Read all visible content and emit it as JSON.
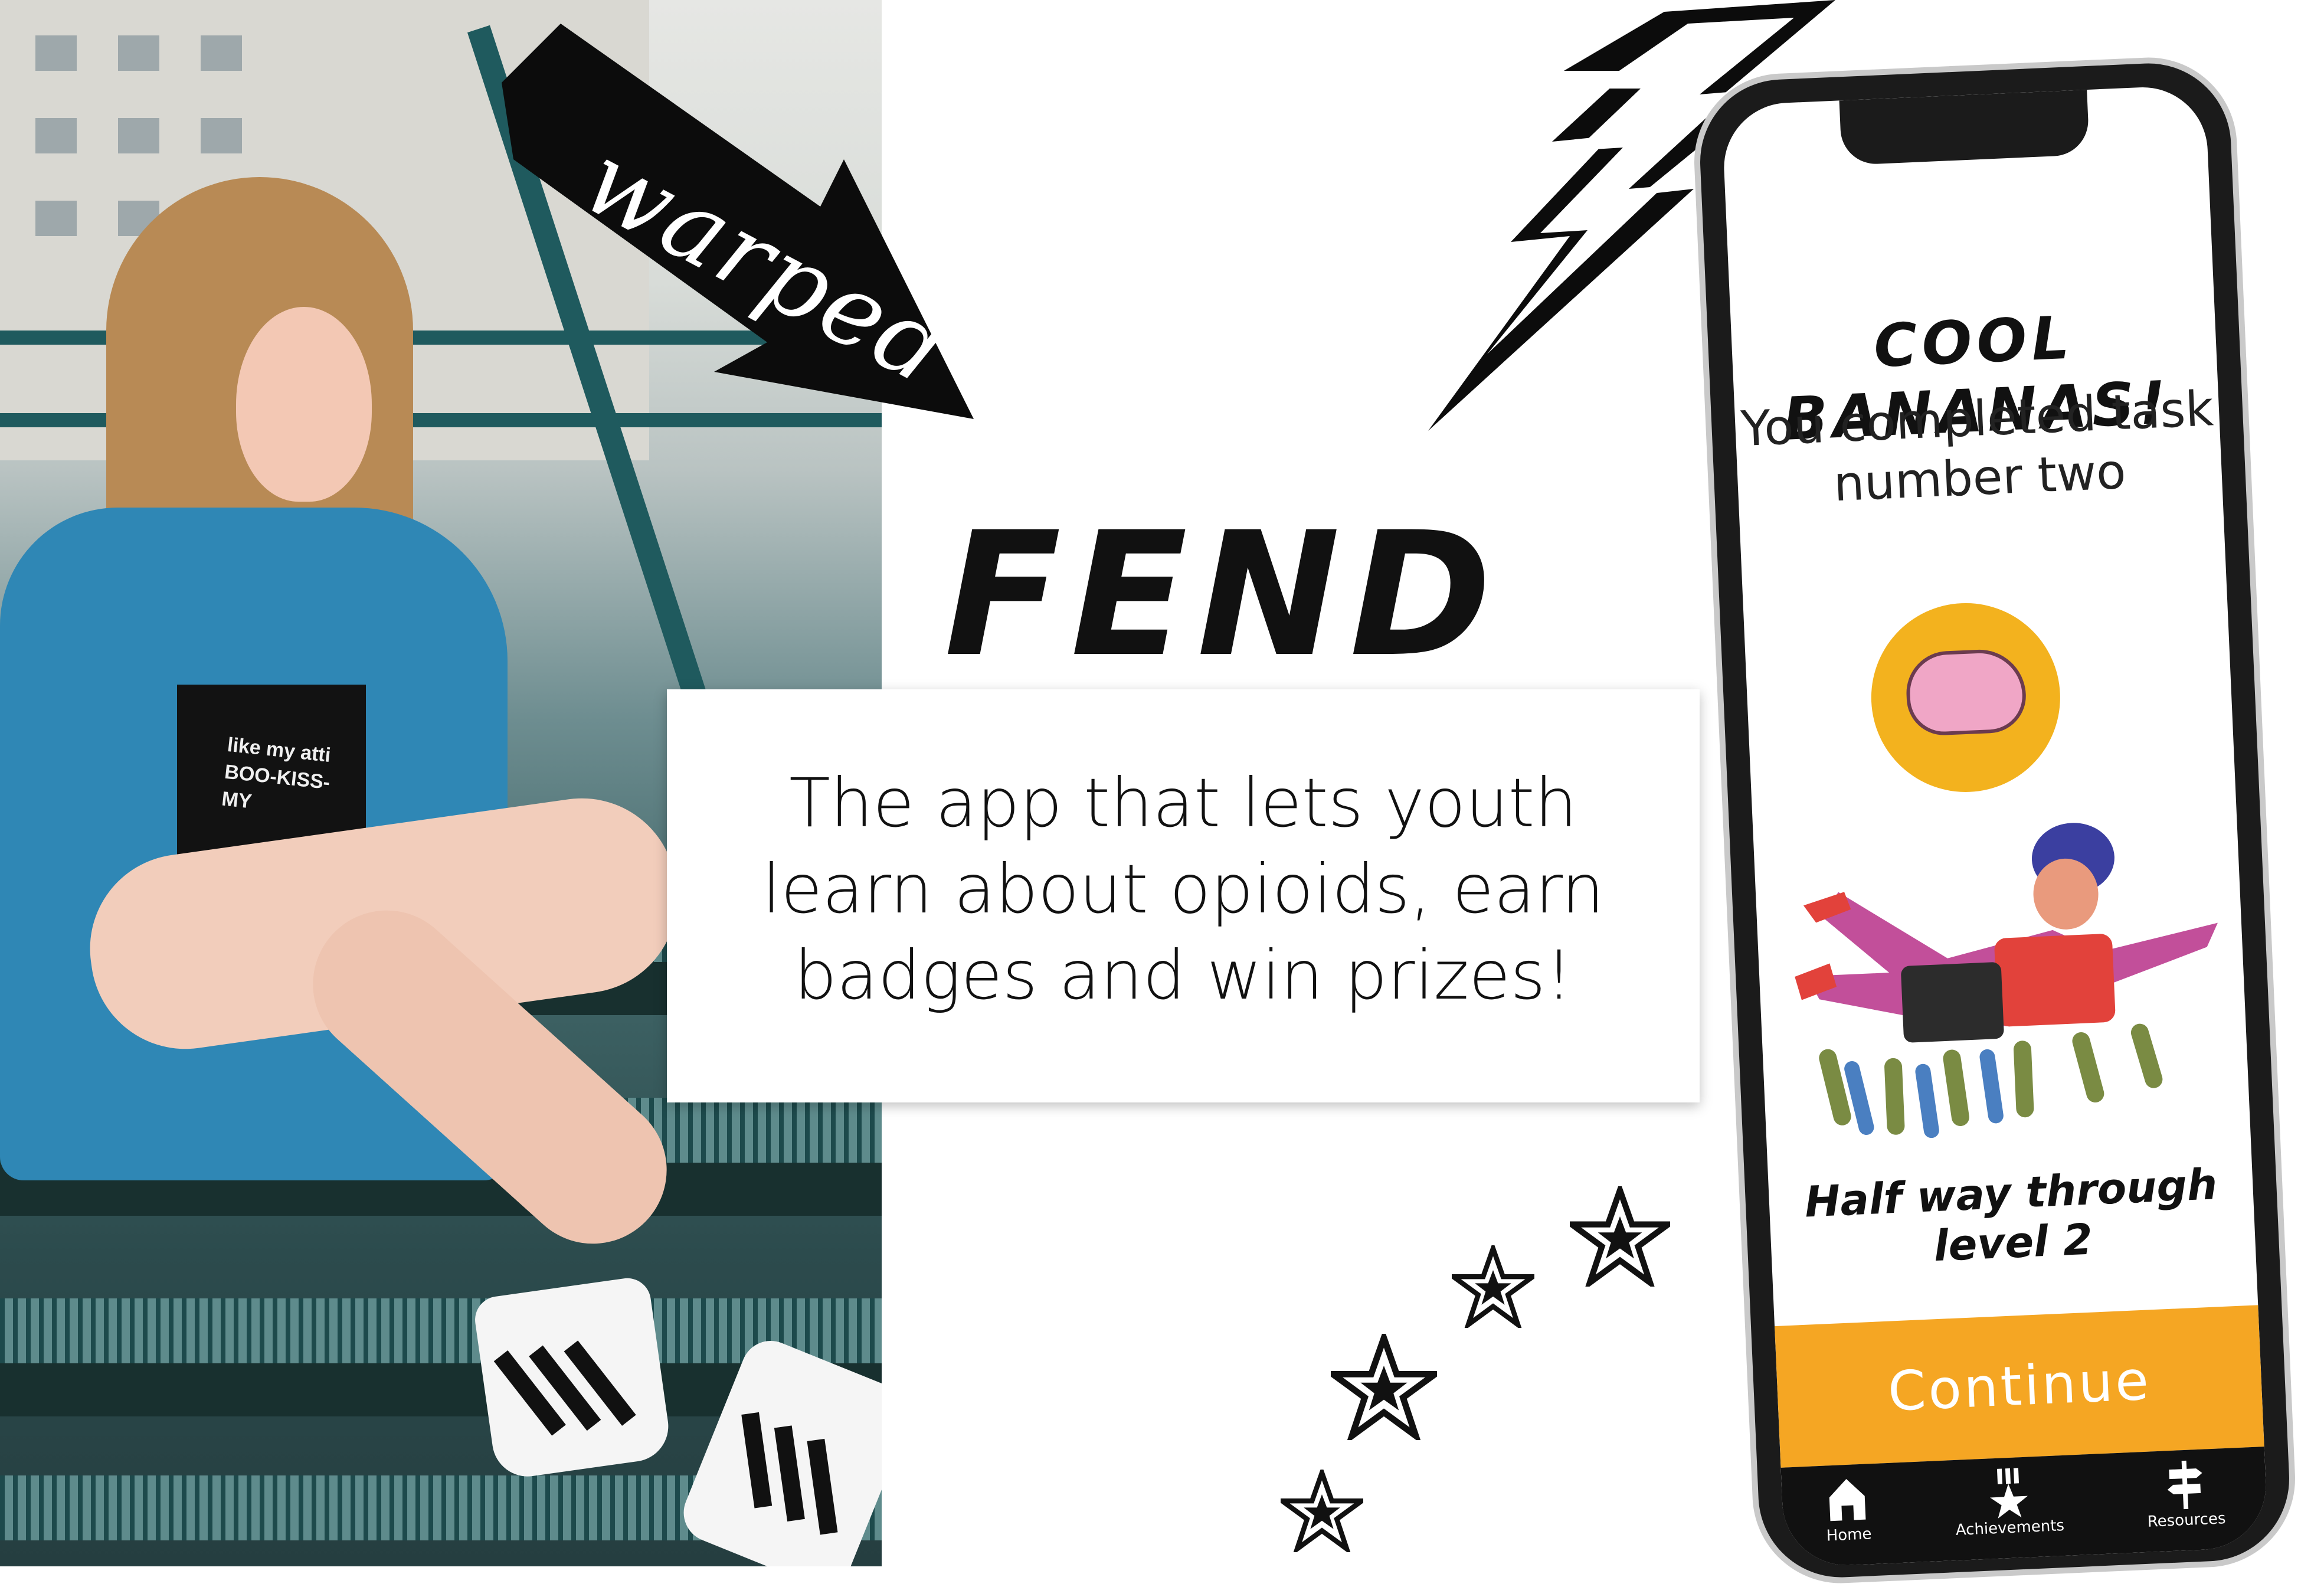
{
  "brand": {
    "sticker_word": "warped",
    "app_name": "FEND",
    "tagline": "The app that lets youth learn about opioids, earn badges and win prizes!"
  },
  "photo": {
    "shirt_text": "like my atti BOO-KISS-MY"
  },
  "phone_screen": {
    "headline": "COOL BANANAS!",
    "message": "You completed task number two",
    "progress_text": "Half way through level 2",
    "progress_fraction": 0.5,
    "continue_label": "Continue",
    "tabs": [
      {
        "label": "Home",
        "icon": "home-icon"
      },
      {
        "label": "Achievements",
        "icon": "star-trophy-icon"
      },
      {
        "label": "Resources",
        "icon": "signpost-icon"
      }
    ]
  },
  "colors": {
    "accent": "#f5a623",
    "sun": "#f3b21e",
    "ink": "#111111",
    "tabbar": "#111111"
  }
}
